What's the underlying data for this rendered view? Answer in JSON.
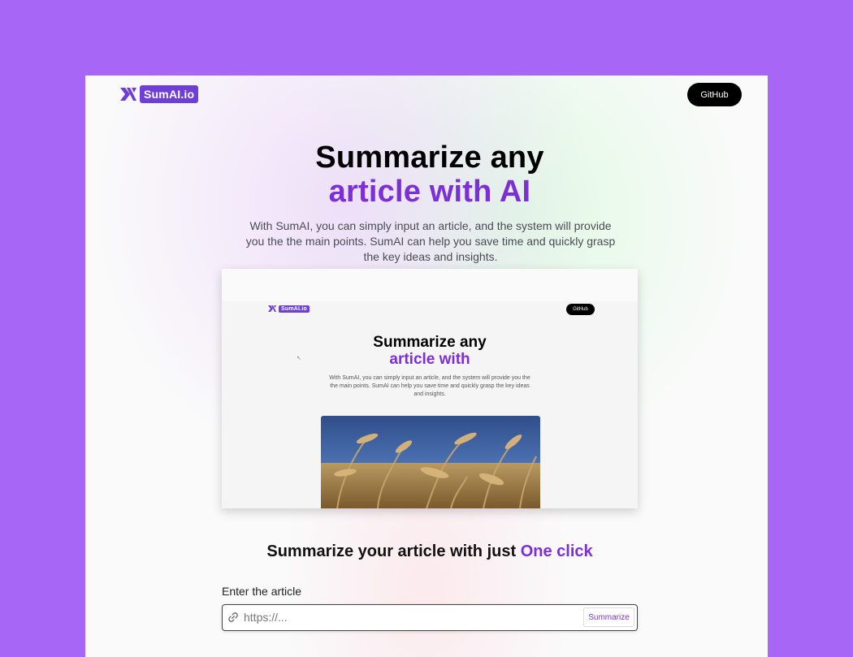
{
  "header": {
    "logo_text": "SumAI.io",
    "github_label": "GitHub"
  },
  "hero": {
    "title_line1": "Summarize any",
    "title_line2": "article with AI",
    "description": "With SumAI, you can simply input an article, and the system will provide you the the main points. SumAI can help you save time and quickly grasp the key ideas and insights."
  },
  "preview": {
    "logo_text": "SumAI.io",
    "github_label": "GitHub",
    "title_line1": "Summarize any",
    "title_line2": "article with",
    "description": "With SumAI, you can simply input an article, and the system will provide you the the main points. SumAI can help you save time and quickly grasp the key ideas and insights."
  },
  "section": {
    "title_prefix": "Summarize your article with just",
    "title_accent": "One click"
  },
  "form": {
    "label": "Enter the article",
    "url_placeholder": "https://...",
    "url_value": "",
    "submit_label": "Summarize"
  },
  "colors": {
    "background": "#a866f7",
    "accent": "#7c2fd6",
    "logo_badge": "#6d3fd6"
  },
  "icons": {
    "logo": "logo-mark-icon",
    "input": "link-icon"
  }
}
